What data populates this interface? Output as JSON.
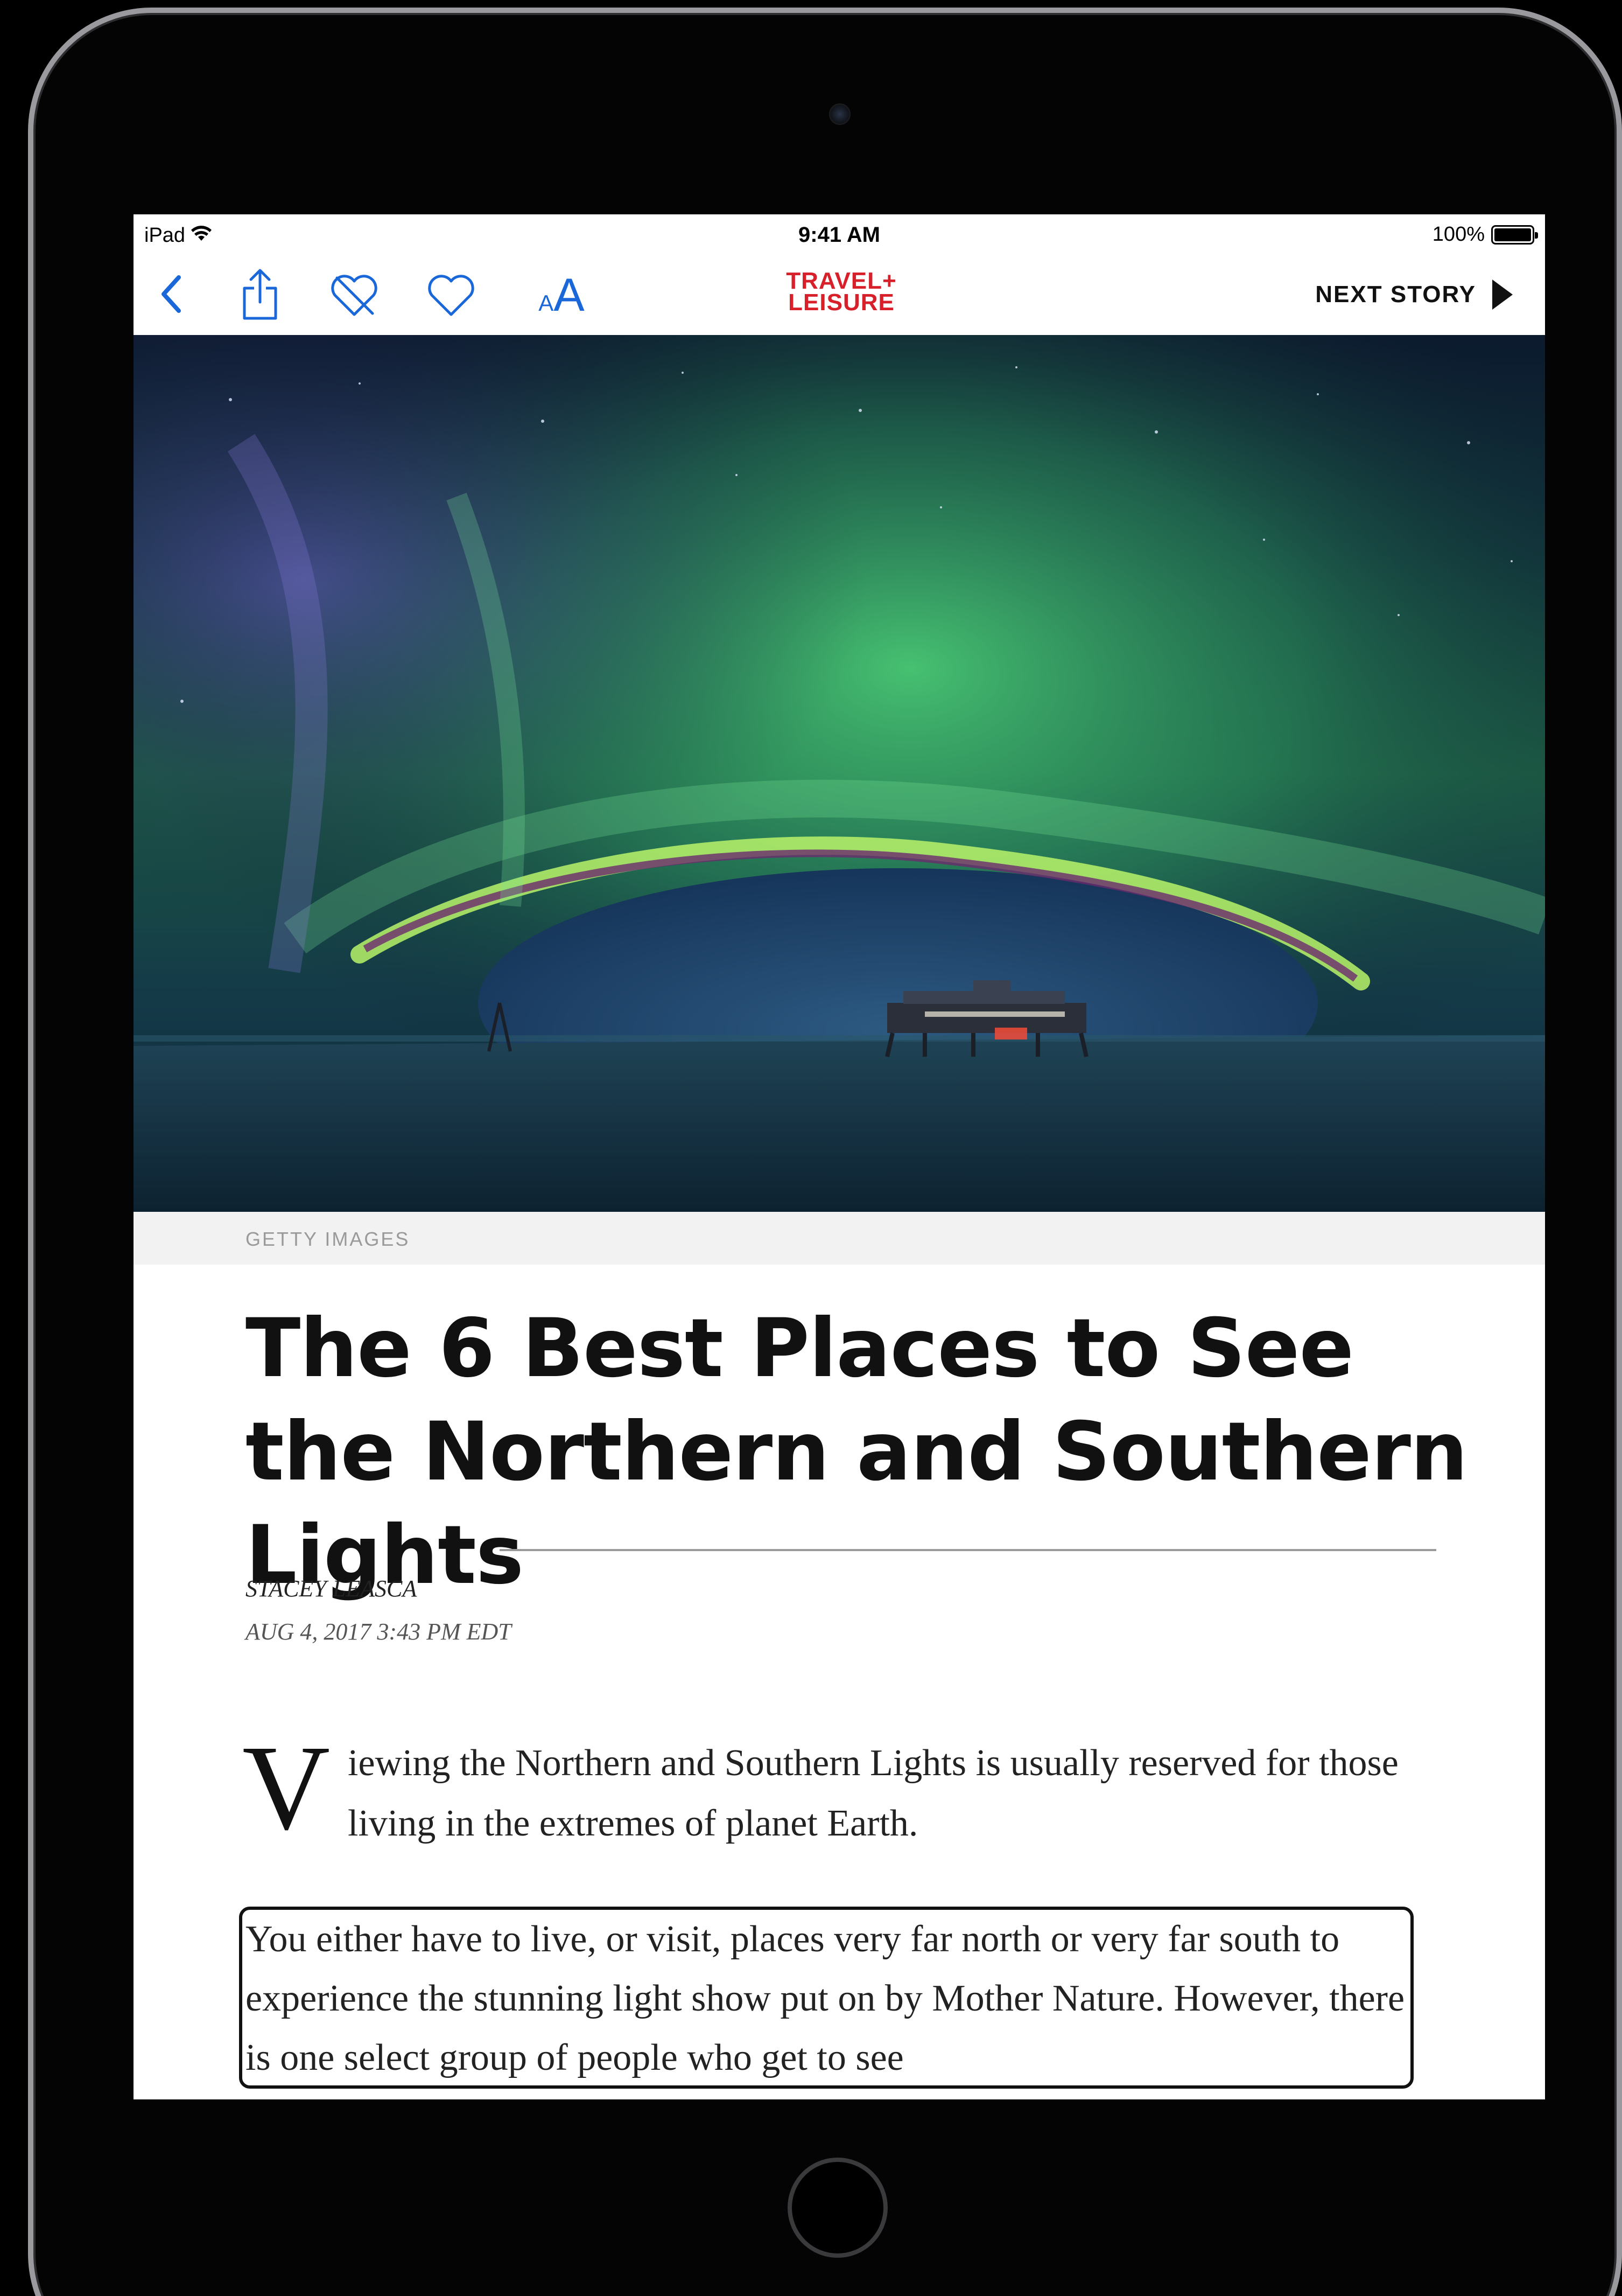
{
  "status_bar": {
    "device": "iPad",
    "time": "9:41 AM",
    "battery": "100%"
  },
  "nav": {
    "icons": [
      "back-chevron-icon",
      "share-icon",
      "unlike-heart-icon",
      "heart-icon",
      "text-size-icon"
    ],
    "text_size_small": "A",
    "text_size_large": "A",
    "logo_line1": "TRAVEL+",
    "logo_line2": "LEISURE",
    "next_story": "NEXT STORY",
    "accent_color": "#1a67d9",
    "logo_color": "#d8202a"
  },
  "hero": {
    "caption": "GETTY IMAGES"
  },
  "article": {
    "title": "The 6 Best Places to See the Northern and Southern Lights",
    "author": "STACEY LEASCA",
    "date": "AUG 4, 2017 3:43 PM EDT",
    "dropcap": "V",
    "lead": "iewing the Northern and Southern Lights is usually reserved for those living in the extremes of planet Earth.",
    "paragraph2": "You either have to live, or visit, places very far north or very far south to experience the stunning light show put on by Mother Nature. However, there is one select group of people who get to see"
  }
}
